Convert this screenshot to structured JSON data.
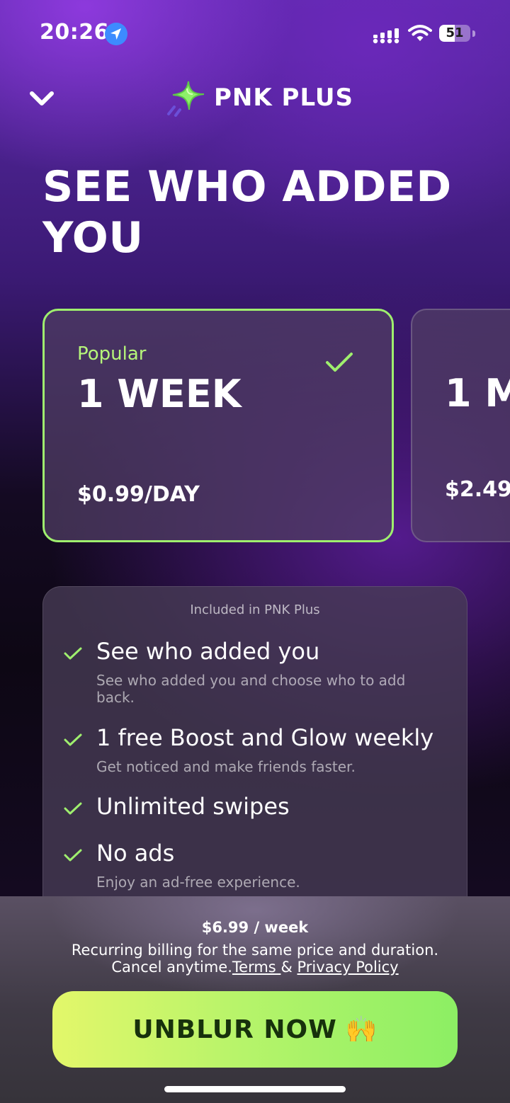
{
  "status_bar": {
    "time": "20:26",
    "battery_level": "51",
    "battery_fraction": 0.51,
    "icons": [
      "location-arrow-icon",
      "cellular-signal-icon",
      "wifi-icon",
      "battery-icon"
    ]
  },
  "header": {
    "brand_name": "PNK PLUS",
    "brand_logo_icon": "sparkle-star-icon",
    "collapse_icon": "chevron-down-icon"
  },
  "headline": "SEE WHO ADDED YOU",
  "plans": [
    {
      "badge": "Popular",
      "title": "1 WEEK",
      "price": "$0.99/DAY",
      "selected": true
    },
    {
      "badge": "",
      "title": "1 M",
      "price": "$2.49",
      "selected": false
    }
  ],
  "features": {
    "title": "Included in PNK Plus",
    "items": [
      {
        "title": "See who added you",
        "desc": "See who added you and choose who to add back."
      },
      {
        "title": "1 free Boost and Glow weekly",
        "desc": "Get noticed and make friends faster."
      },
      {
        "title": "Unlimited swipes",
        "desc": ""
      },
      {
        "title": "No ads",
        "desc": "Enjoy an ad-free experience."
      }
    ]
  },
  "billing": {
    "price": "$6.99 / week",
    "line1": "Recurring billing for the same price and duration.",
    "line2_prefix": "Cancel anytime.",
    "terms_link": "Terms ",
    "amp": " & ",
    "privacy_link": "Privacy Policy"
  },
  "cta": {
    "label": "UNBLUR NOW",
    "emoji": "🙌"
  },
  "colors": {
    "accent_green": "#9fef6e",
    "cta_gradient_start": "#e3f76a",
    "cta_gradient_end": "#8cef64",
    "cta_text": "#17310c"
  }
}
